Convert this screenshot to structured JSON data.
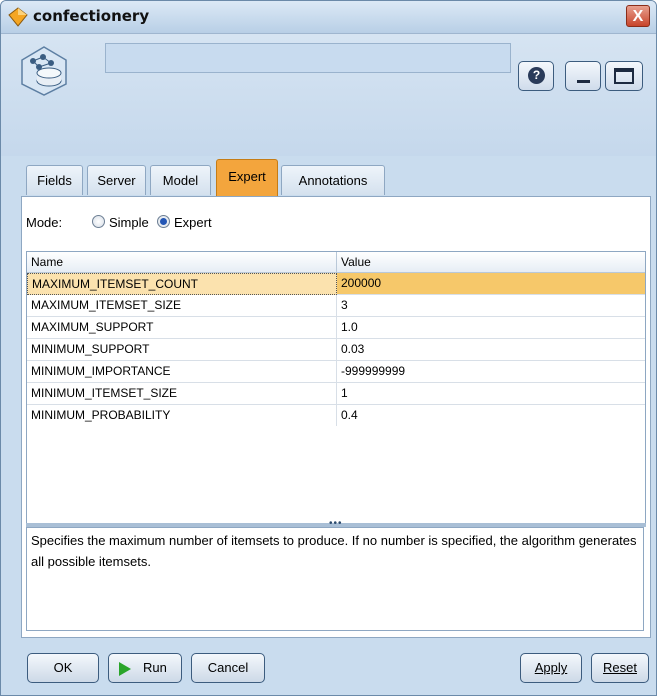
{
  "window": {
    "title": "confectionery",
    "close_glyph": "X"
  },
  "header": {
    "help_glyph": "?"
  },
  "tabs": [
    {
      "label": "Fields",
      "active": false
    },
    {
      "label": "Server",
      "active": false
    },
    {
      "label": "Model",
      "active": false
    },
    {
      "label": "Expert",
      "active": true
    },
    {
      "label": "Annotations",
      "active": false
    }
  ],
  "mode": {
    "label": "Mode:",
    "options": [
      "Simple",
      "Expert"
    ],
    "selected": "Expert"
  },
  "grid": {
    "columns": [
      "Name",
      "Value"
    ],
    "rows": [
      {
        "name": "MAXIMUM_ITEMSET_COUNT",
        "value": "200000"
      },
      {
        "name": "MAXIMUM_ITEMSET_SIZE",
        "value": "3"
      },
      {
        "name": "MAXIMUM_SUPPORT",
        "value": "1.0"
      },
      {
        "name": "MINIMUM_SUPPORT",
        "value": "0.03"
      },
      {
        "name": "MINIMUM_IMPORTANCE",
        "value": "-999999999"
      },
      {
        "name": "MINIMUM_ITEMSET_SIZE",
        "value": "1"
      },
      {
        "name": "MINIMUM_PROBABILITY",
        "value": "0.4"
      }
    ],
    "selected_row": 0
  },
  "description": "Specifies the maximum number of itemsets to produce. If no number is specified, the algorithm generates all possible itemsets.",
  "buttons": {
    "ok": "OK",
    "run": "Run",
    "cancel": "Cancel",
    "apply": "Apply",
    "reset": "Reset"
  },
  "colors": {
    "active_tab": "#f3a53d",
    "selected_row": "#f6c86a",
    "run_icon": "#2aa52a"
  }
}
